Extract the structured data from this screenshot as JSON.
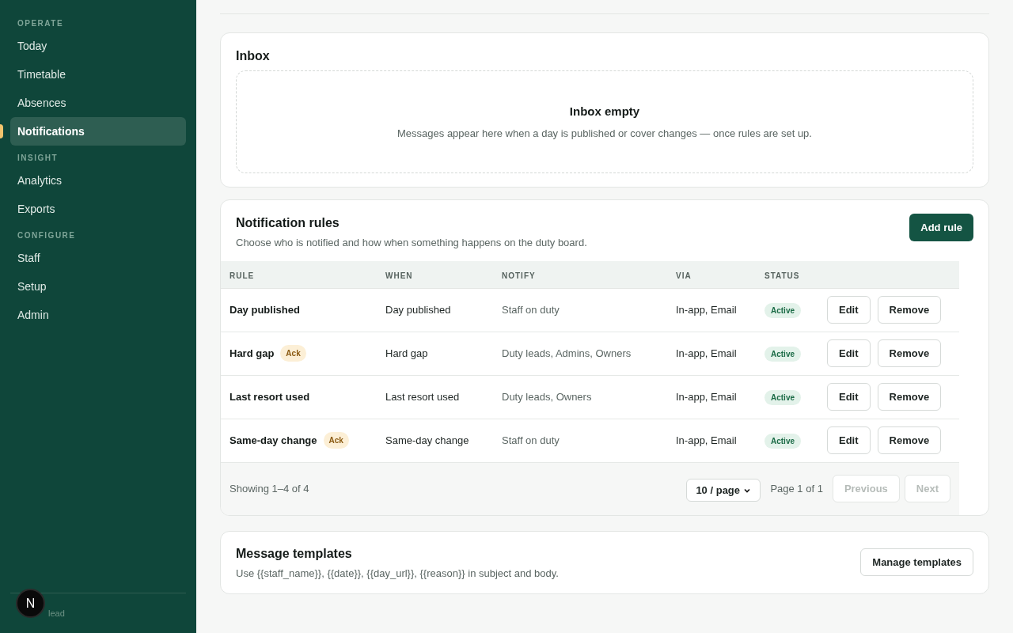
{
  "sidebar": {
    "sections": [
      {
        "heading": "OPERATE",
        "items": [
          {
            "label": "Today",
            "selected": false
          },
          {
            "label": "Timetable",
            "selected": false
          },
          {
            "label": "Absences",
            "selected": false
          },
          {
            "label": "Notifications",
            "selected": true
          }
        ]
      },
      {
        "heading": "INSIGHT",
        "items": [
          {
            "label": "Analytics",
            "selected": false
          },
          {
            "label": "Exports",
            "selected": false
          }
        ]
      },
      {
        "heading": "CONFIGURE",
        "items": [
          {
            "label": "Staff",
            "selected": false
          },
          {
            "label": "Setup",
            "selected": false
          },
          {
            "label": "Admin",
            "selected": false
          }
        ]
      }
    ],
    "footer": "lead",
    "badge": "N"
  },
  "inbox": {
    "title": "Inbox",
    "empty_title": "Inbox empty",
    "empty_text": "Messages appear here when a day is published or cover changes — once rules are set up."
  },
  "rules": {
    "title": "Notification rules",
    "subtitle": "Choose who is notified and how when something happens on the duty board.",
    "add_button": "Add rule",
    "columns": [
      "RULE",
      "WHEN",
      "NOTIFY",
      "VIA",
      "STATUS"
    ],
    "rows": [
      {
        "rule": "Day published",
        "tag": null,
        "when": "Day published",
        "notify": "Staff on duty",
        "via": "In-app, Email",
        "status": "Active",
        "edit": "Edit",
        "remove": "Remove"
      },
      {
        "rule": "Hard gap",
        "tag": "Ack",
        "when": "Hard gap",
        "notify": "Duty leads, Admins, Owners",
        "via": "In-app, Email",
        "status": "Active",
        "edit": "Edit",
        "remove": "Remove"
      },
      {
        "rule": "Last resort used",
        "tag": null,
        "when": "Last resort used",
        "notify": "Duty leads, Owners",
        "via": "In-app, Email",
        "status": "Active",
        "edit": "Edit",
        "remove": "Remove"
      },
      {
        "rule": "Same-day change",
        "tag": "Ack",
        "when": "Same-day change",
        "notify": "Staff on duty",
        "via": "In-app, Email",
        "status": "Active",
        "edit": "Edit",
        "remove": "Remove"
      }
    ],
    "footer": {
      "showing": "Showing 1–4 of 4",
      "page_size": "10 / page",
      "page": "Page 1 of 1",
      "previous": "Previous",
      "next": "Next",
      "previous_disabled": true,
      "next_disabled": true
    }
  },
  "templates": {
    "title": "Message templates",
    "text": "Use {{staff_name}}, {{date}}, {{day_url}}, {{reason}} in subject and body.",
    "button": "Manage templates"
  }
}
